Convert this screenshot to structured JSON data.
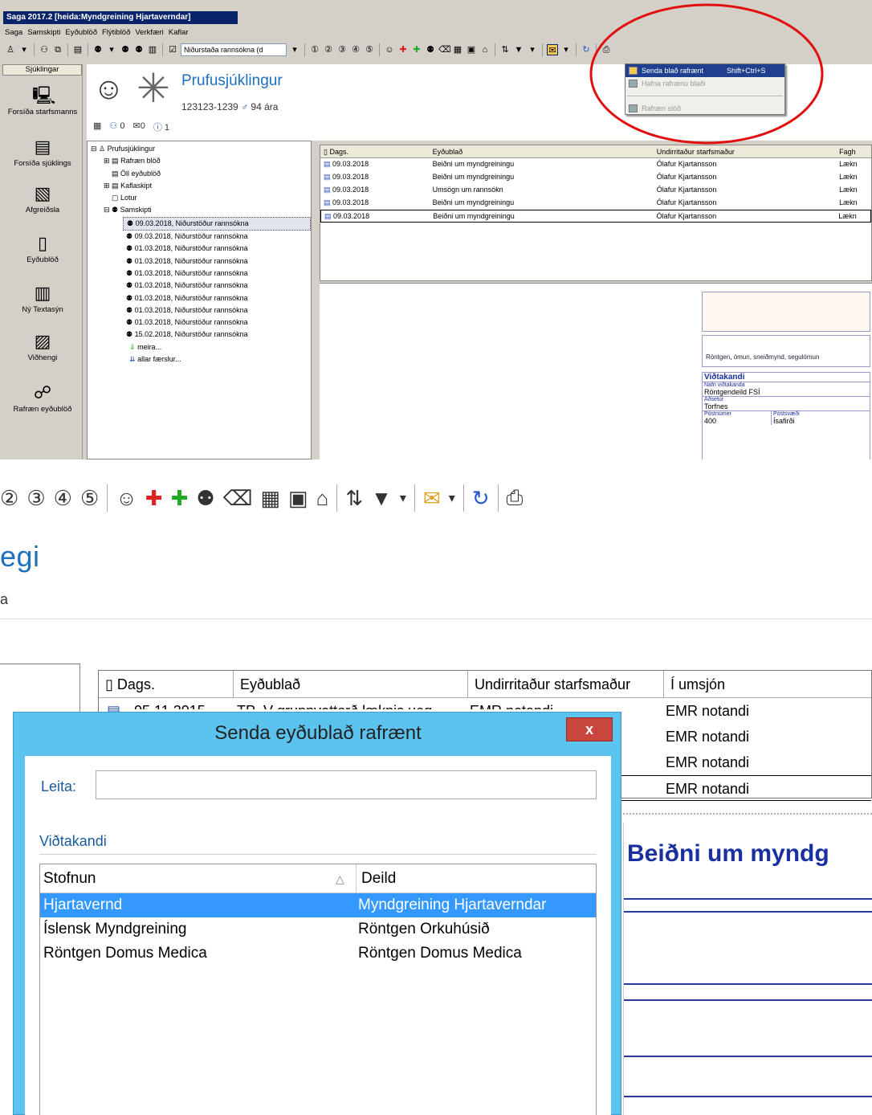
{
  "app": {
    "title": "Saga 2017.2  [heida:Myndgreining Hjartaverndar]",
    "menu": [
      "Saga",
      "Samskipti",
      "Eyðublöð",
      "Flýtiblöð",
      "Verkfæri",
      "Kaflar"
    ],
    "result_combo": "Niðurstaða rannsókna (d"
  },
  "leftnav": {
    "header": "Sjúklingar",
    "items": [
      {
        "label": "Forsíða starfsmanns",
        "icon": "staff-home-icon"
      },
      {
        "label": "Forsíða sjúklings",
        "icon": "patient-home-icon"
      },
      {
        "label": "Afgreiðsla",
        "icon": "reception-icon"
      },
      {
        "label": "Eyðublöð",
        "icon": "forms-icon"
      },
      {
        "label": "Ný Textasýn",
        "icon": "text-view-icon"
      },
      {
        "label": "Viðhengi",
        "icon": "attachment-icon"
      },
      {
        "label": "Rafræn eyðublöð",
        "icon": "electronic-forms-icon"
      }
    ]
  },
  "patient": {
    "name": "Prufusjúklingur",
    "id_line": "123123-1239",
    "gender_symbol": "♂",
    "age": "94 ára",
    "counts": {
      "a": "0",
      "b": "0",
      "c": "1"
    }
  },
  "tree": {
    "root": "Prufusjúklingur",
    "nodes": [
      "Rafræn blöð",
      "Öll eyðublöð",
      "Kaflaskipt",
      "Lotur",
      "Samskipti"
    ],
    "entries": [
      "09.03.2018, Niðurstöður rannsókna",
      "09.03.2018, Niðurstöður rannsókna",
      "01.03.2018, Niðurstöður rannsókna",
      "01.03.2018, Niðurstöður rannsókna",
      "01.03.2018, Niðurstöður rannsókna",
      "01.03.2018, Niðurstöður rannsókna",
      "01.03.2018, Niðurstöður rannsókna",
      "01.03.2018, Niðurstöður rannsókna",
      "01.03.2018, Niðurstöður rannsókna",
      "15.02.2018, Niðurstöður rannsókna"
    ],
    "more": "meira...",
    "all": "allar færslur..."
  },
  "grid": {
    "headers": [
      "Dags.",
      "Eyðublað",
      "Undirritaður starfsmaður",
      "Fagh"
    ],
    "rows": [
      [
        "09.03.2018",
        "Beiðni um myndgreiningu",
        "Ólafur Kjartansson",
        "Lækn"
      ],
      [
        "09.03.2018",
        "Beiðni um myndgreiningu",
        "Ólafur Kjartansson",
        "Lækn"
      ],
      [
        "09.03.2018",
        "Umsögn um rannsókn",
        "Ólafur Kjartansson",
        "Lækn"
      ],
      [
        "09.03.2018",
        "Beiðni um myndgreiningu",
        "Ólafur Kjartansson",
        "Lækn"
      ],
      [
        "09.03.2018",
        "Beiðni um myndgreiningu",
        "Ólafur Kjartansson",
        "Lækn"
      ]
    ]
  },
  "preview": {
    "modalities": "Röntgen, ómun, sneiðmynd, segulómun",
    "recipient_title": "Viðtakandi",
    "recipient_name_label": "Nafn viðtakanda",
    "recipient_name": "Röntgendeild FSÍ",
    "address_label": "Aðsetur",
    "address": "Torfnes",
    "postcode_label": "Póstnúmer",
    "postcode": "400",
    "postarea_label": "Póstsvæði",
    "postarea": "Ísafirði"
  },
  "dropdown": {
    "items": [
      {
        "label": "Senda blað rafrænt",
        "shortcut": "Shift+Ctrl+S",
        "state": "active"
      },
      {
        "label": "Hafna rafrænu blaði",
        "shortcut": "",
        "state": "disabled"
      },
      {
        "label": "Rafræn slóð",
        "shortcut": "",
        "state": "disabled"
      }
    ]
  },
  "zoom_mid": {
    "name_fragment": "egi",
    "sub_fragment": "a"
  },
  "zoom_bottom": {
    "grid_headers": [
      "Dags.",
      "Eyðublað",
      "Undirritaður starfsmaður",
      "Í umsjón"
    ],
    "first_row_partial": [
      "05.11.2015",
      "TP_V grunnyottorð læknis ueg",
      "EMR notandi"
    ],
    "umsjon_rows": [
      "EMR notandi",
      "EMR notandi",
      "EMR notandi",
      "EMR notandi"
    ],
    "form_title": "Beiðni um myndg"
  },
  "dialog": {
    "title": "Senda eyðublað rafrænt",
    "close": "x",
    "search_label": "Leita:",
    "search_value": "",
    "section": "Viðtakandi",
    "columns": [
      "Stofnun",
      "Deild"
    ],
    "rows": [
      [
        "Hjartavernd",
        "Myndgreining Hjartaverndar"
      ],
      [
        "Íslensk Myndgreining",
        "Röntgen Orkuhúsið"
      ],
      [
        "Röntgen Domus Medica",
        "Röntgen Domus Medica"
      ]
    ],
    "selected_row": 0
  },
  "colors": {
    "titlebar": "#0a246a",
    "accent_blue": "#1f6fbf",
    "dialog_frame": "#5bc3ee",
    "close_red": "#c9463d",
    "selection": "#3399ff",
    "annotation_red": "#e01010"
  }
}
